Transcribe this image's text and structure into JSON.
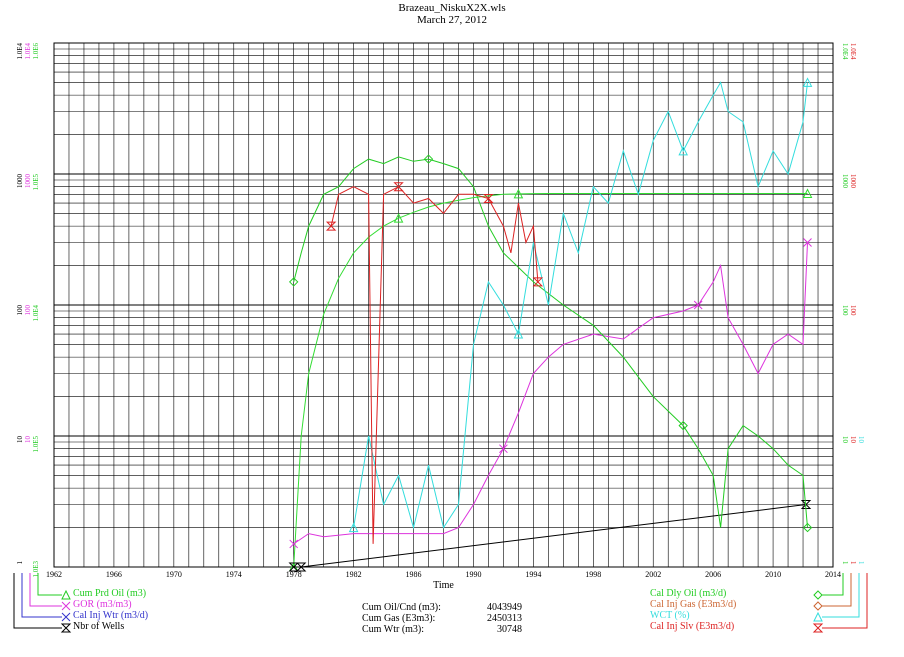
{
  "header": {
    "title": "Brazeau_NiskuX2X.wls",
    "date": "March 27, 2012"
  },
  "chart_data": {
    "type": "line",
    "xlabel": "Time",
    "x_ticks": [
      "1962",
      "1966",
      "1970",
      "1974",
      "1978",
      "1982",
      "1986",
      "1990",
      "1994",
      "1998",
      "2002",
      "2006",
      "2010",
      "2014"
    ],
    "xlim": [
      1962,
      2014
    ],
    "y_scale": "log",
    "ylim": [
      1,
      10000
    ],
    "grid": true,
    "left_axis_labels": {
      "black": [
        "1",
        "10",
        "100",
        "1000",
        "1.0E4"
      ],
      "magenta": [
        "",
        "10",
        "100",
        "1000",
        "1.0E4"
      ],
      "green": [
        "1.0E3",
        "1.0E5",
        "1.0E4",
        "1.0E5",
        "1.0E6"
      ]
    },
    "right_axis_labels": {
      "green": [
        "1",
        "10",
        "100",
        "1000",
        "1.0E4"
      ],
      "red": [
        "1",
        "10",
        "100",
        "1000",
        "1.0E4"
      ],
      "cyan": [
        "1",
        "10",
        "",
        "",
        ""
      ]
    },
    "series": [
      {
        "name": "Cum Prd Oil (m3)",
        "color": "#33dd33",
        "marker": "triangle",
        "x": [
          1978.0,
          1978.5,
          1979,
          1980,
          1981,
          1982,
          1983,
          1984,
          1985,
          1986,
          1987,
          1988,
          1989,
          1990,
          1991,
          1992,
          1993,
          1994,
          1995,
          1996,
          2000,
          2005,
          2010,
          2012.3
        ],
        "y": [
          1,
          10,
          30,
          85,
          160,
          250,
          330,
          400,
          460,
          510,
          560,
          600,
          630,
          660,
          680,
          700,
          705,
          708,
          710,
          710,
          710,
          710,
          710,
          710
        ]
      },
      {
        "name": "GOR (m3/m3)",
        "color": "#dd33dd",
        "marker": "x",
        "x": [
          1978,
          1979,
          1980,
          1982,
          1985,
          1988,
          1989,
          1990,
          1991,
          1992,
          1993,
          1994,
          1995,
          1996,
          1998,
          2000,
          2002,
          2004,
          2005,
          2006,
          2006.5,
          2007,
          2008,
          2009,
          2010,
          2011,
          2012,
          2012.3
        ],
        "y": [
          1.5,
          1.8,
          1.7,
          1.8,
          1.8,
          1.8,
          2,
          3,
          5,
          8,
          15,
          30,
          40,
          50,
          60,
          55,
          80,
          90,
          100,
          150,
          200,
          80,
          50,
          30,
          50,
          60,
          50,
          300
        ]
      },
      {
        "name": "Cal Inj Wtr (m3/d)",
        "color": "#3333cc",
        "marker": "x",
        "x": [],
        "y": []
      },
      {
        "name": "Nbr of Wells",
        "color": "#000000",
        "marker": "hourglass",
        "x": [
          1978,
          1978.5,
          2012.2
        ],
        "y": [
          1,
          1,
          3
        ]
      },
      {
        "name": "Cal Dly Oil (m3/d)",
        "color": "#22cc22",
        "marker": "diamond",
        "x": [
          1978,
          1978.5,
          1979,
          1980,
          1981,
          1982,
          1983,
          1984,
          1985,
          1986,
          1987,
          1988,
          1989,
          1990,
          1991,
          1992,
          1994,
          1996,
          1998,
          2000,
          2002,
          2004,
          2005,
          2006,
          2006.5,
          2007,
          2008,
          2009,
          2010,
          2011,
          2012,
          2012.3
        ],
        "y": [
          150,
          250,
          400,
          700,
          800,
          1100,
          1300,
          1200,
          1350,
          1250,
          1300,
          1200,
          1100,
          800,
          400,
          250,
          150,
          100,
          70,
          40,
          20,
          12,
          8,
          5,
          2,
          8,
          12,
          10,
          8,
          6,
          5,
          2
        ]
      },
      {
        "name": "Cal Inj Gas (E3m3/d)",
        "color": "#cc6633",
        "marker": "diamond",
        "x": [],
        "y": []
      },
      {
        "name": "WCT (%)",
        "color": "#33dddd",
        "marker": "triangle",
        "x": [
          1982,
          1983,
          1984,
          1985,
          1986,
          1987,
          1988,
          1989,
          1990,
          1991,
          1992,
          1993,
          1994,
          1995,
          1996,
          1997,
          1998,
          1999,
          2000,
          2001,
          2002,
          2003,
          2004,
          2005,
          2006,
          2006.5,
          2007,
          2008,
          2009,
          2010,
          2011,
          2012,
          2012.3
        ],
        "y": [
          2,
          10,
          3,
          5,
          2,
          6,
          2,
          3,
          50,
          150,
          100,
          60,
          300,
          100,
          500,
          250,
          800,
          600,
          1500,
          700,
          1800,
          3000,
          1500,
          2500,
          4000,
          5000,
          3000,
          2500,
          800,
          1500,
          1000,
          2500,
          5000
        ]
      },
      {
        "name": "Cal Inj Slv (E3m3/d)",
        "color": "#dd2222",
        "marker": "hourglass",
        "x": [
          1980.5,
          1981,
          1982,
          1983,
          1983.3,
          1984,
          1985,
          1986,
          1987,
          1988,
          1989,
          1990,
          1991,
          1992,
          1992.5,
          1993,
          1993.5,
          1994,
          1994.3
        ],
        "y": [
          400,
          700,
          800,
          700,
          1.5,
          700,
          800,
          600,
          650,
          500,
          700,
          700,
          650,
          400,
          250,
          600,
          300,
          400,
          150
        ]
      }
    ]
  },
  "legend_left": [
    {
      "label": "Cum Prd Oil (m3)",
      "color": "#22cc22",
      "icon": "triangle-icon"
    },
    {
      "label": "GOR (m3/m3)",
      "color": "#dd33dd",
      "icon": "x-icon"
    },
    {
      "label": "Cal Inj Wtr (m3/d)",
      "color": "#3333cc",
      "icon": "x-icon"
    },
    {
      "label": "Nbr of Wells",
      "color": "#000000",
      "icon": "hourglass-icon"
    }
  ],
  "legend_right": [
    {
      "label": "Cal Dly Oil (m3/d)",
      "color": "#22cc22",
      "icon": "diamond-icon"
    },
    {
      "label": "Cal Inj Gas (E3m3/d)",
      "color": "#cc6633",
      "icon": "diamond-icon"
    },
    {
      "label": "WCT (%)",
      "color": "#33dddd",
      "icon": "triangle-icon"
    },
    {
      "label": "Cal Inj Slv (E3m3/d)",
      "color": "#dd2222",
      "icon": "hourglass-icon"
    }
  ],
  "stats": [
    {
      "label": "Cum Oil/Cnd (m3):",
      "value": "4043949"
    },
    {
      "label": "Cum Gas (E3m3):",
      "value": "2450313"
    },
    {
      "label": "Cum Wtr (m3):",
      "value": "30748"
    }
  ]
}
